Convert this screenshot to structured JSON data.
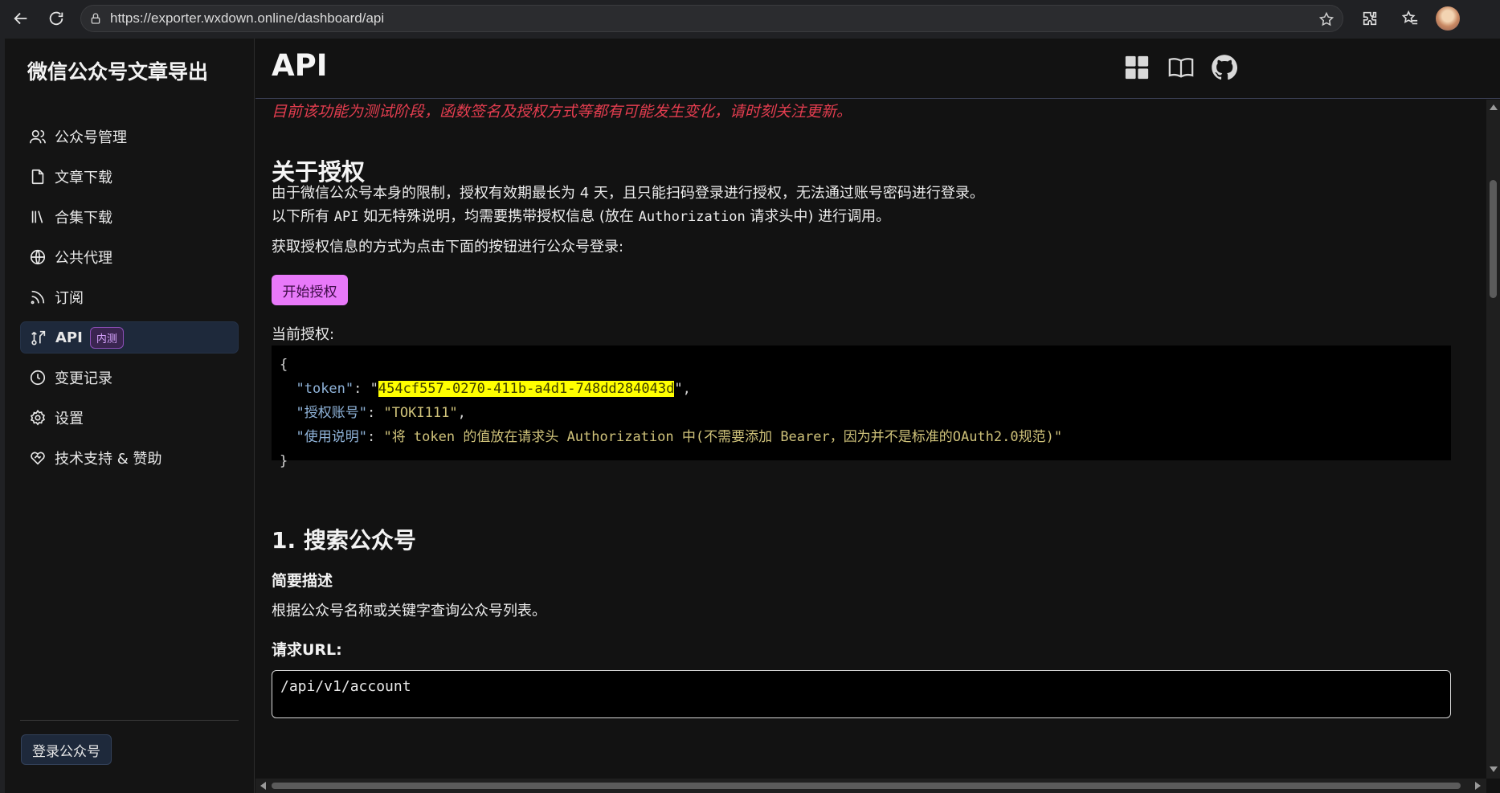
{
  "browser": {
    "url": "https://exporter.wxdown.online/dashboard/api"
  },
  "sidebar": {
    "brand": "微信公众号文章导出",
    "items": [
      {
        "label": "公众号管理",
        "icon": "users-icon"
      },
      {
        "label": "文章下载",
        "icon": "file-icon"
      },
      {
        "label": "合集下载",
        "icon": "library-icon"
      },
      {
        "label": "公共代理",
        "icon": "globe-icon"
      },
      {
        "label": "订阅",
        "icon": "rss-icon"
      },
      {
        "label": "API",
        "icon": "route-icon",
        "badge": "内测",
        "active": true
      },
      {
        "label": "变更记录",
        "icon": "clock-icon"
      },
      {
        "label": "设置",
        "icon": "gear-icon"
      },
      {
        "label": "技术支持 & 赞助",
        "icon": "heart-handshake-icon"
      }
    ],
    "login_button": "登录公众号"
  },
  "header": {
    "title": "API"
  },
  "main": {
    "warning": "目前该功能为测试阶段，函数签名及授权方式等都有可能发生变化，请时刻关注更新。",
    "auth_heading": "关于授权",
    "auth_p1": "由于微信公众号本身的限制，授权有效期最长为 4 天，且只能扫码登录进行授权，无法通过账号密码进行登录。",
    "auth_p2_a": "以下所有 ",
    "auth_p2_api": "API",
    "auth_p2_b": " 如无特殊说明，均需要携带授权信息 (放在 ",
    "auth_p2_header": "Authorization",
    "auth_p2_c": " 请求头中) 进行调用。",
    "auth_p3": "获取授权信息的方式为点击下面的按钮进行公众号登录:",
    "start_auth_button": "开始授权",
    "current_auth_label": "当前授权:",
    "code": {
      "open": "{",
      "close": "}",
      "token_key": "\"token\"",
      "token_value": "454cf557-0270-411b-a4d1-748dd284043d",
      "account_key": "\"授权账号\"",
      "account_value": "\"TOKI111\"",
      "usage_key": "\"使用说明\"",
      "usage_value": "\"将 token 的值放在请求头 Authorization 中(不需要添加 Bearer，因为并不是标准的OAuth2.0规范)\""
    },
    "api1_heading": "1. 搜索公众号",
    "api1_desc_heading": "简要描述",
    "api1_desc": "根据公众号名称或关键字查询公众号列表。",
    "api1_url_heading": "请求URL:",
    "api1_url": "/api/v1/account"
  },
  "colors": {
    "warning": "#e43d4f",
    "accent_button": "#e879f9",
    "token_highlight": "#ffff00",
    "active_item_bg": "#1e293b"
  }
}
